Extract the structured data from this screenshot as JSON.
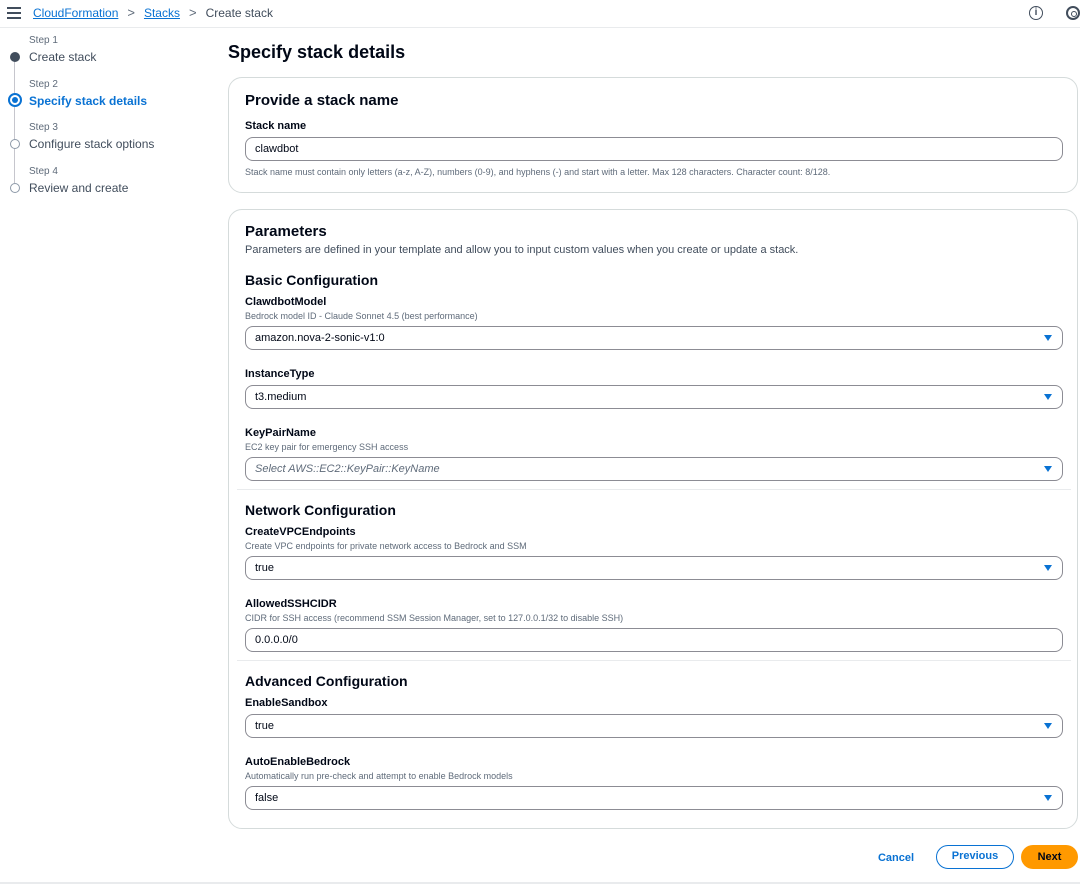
{
  "topbar": {
    "breadcrumbs": [
      "CloudFormation",
      "Stacks",
      "Create stack"
    ],
    "separator": ">"
  },
  "steps": [
    {
      "num": "Step 1",
      "label": "Create stack",
      "state": "done"
    },
    {
      "num": "Step 2",
      "label": "Specify stack details",
      "state": "current"
    },
    {
      "num": "Step 3",
      "label": "Configure stack options",
      "state": "todo"
    },
    {
      "num": "Step 4",
      "label": "Review and create",
      "state": "todo"
    }
  ],
  "page_title": "Specify stack details",
  "stack_name_card": {
    "title": "Provide a stack name",
    "field_label": "Stack name",
    "value": "clawdbot",
    "help": "Stack name must contain only letters (a-z, A-Z), numbers (0-9), and hyphens (-) and start with a letter. Max 128 characters. Character count: 8/128."
  },
  "parameters": {
    "title": "Parameters",
    "description": "Parameters are defined in your template and allow you to input custom values when you create or update a stack.",
    "basic": {
      "title": "Basic Configuration",
      "model_label": "ClawdbotModel",
      "model_desc": "Bedrock model ID - Claude Sonnet 4.5 (best performance)",
      "model_value": "amazon.nova-2-sonic-v1:0",
      "instance_label": "InstanceType",
      "instance_value": "t3.medium",
      "keypair_label": "KeyPairName",
      "keypair_desc": "EC2 key pair for emergency SSH access",
      "keypair_placeholder": "Select AWS::EC2::KeyPair::KeyName"
    },
    "network": {
      "title": "Network Configuration",
      "vpc_label": "CreateVPCEndpoints",
      "vpc_desc": "Create VPC endpoints for private network access to Bedrock and SSM",
      "vpc_value": "true",
      "ssh_label": "AllowedSSHCIDR",
      "ssh_desc": "CIDR for SSH access (recommend SSM Session Manager, set to 127.0.0.1/32 to disable SSH)",
      "ssh_value": "0.0.0.0/0"
    },
    "advanced": {
      "title": "Advanced Configuration",
      "sandbox_label": "EnableSandbox",
      "sandbox_value": "true",
      "bedrock_label": "AutoEnableBedrock",
      "bedrock_desc": "Automatically run pre-check and attempt to enable Bedrock models",
      "bedrock_value": "false"
    }
  },
  "footer": {
    "cancel": "Cancel",
    "previous": "Previous",
    "next": "Next"
  },
  "colors": {
    "accent": "#0972d3",
    "primary_button": "#ff9900"
  }
}
